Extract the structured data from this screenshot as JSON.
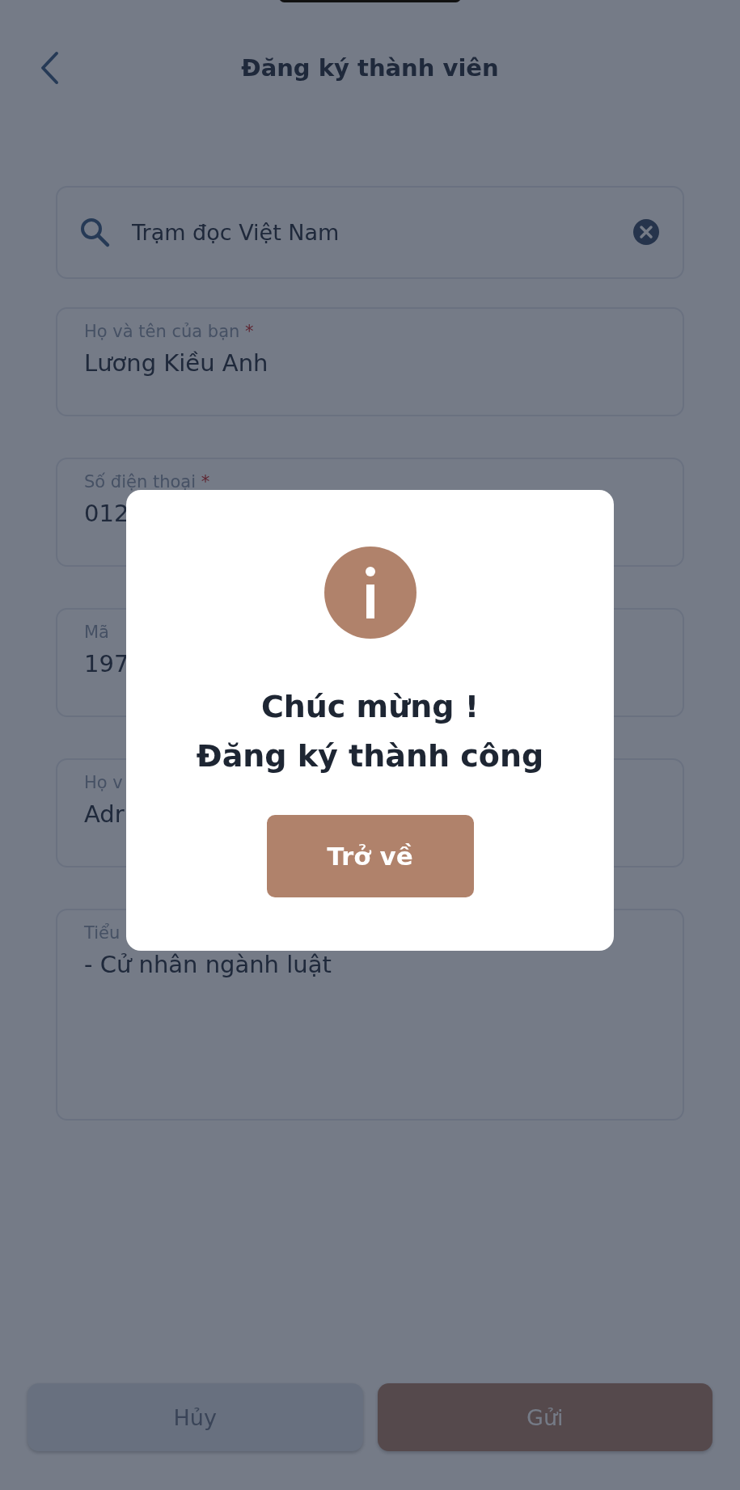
{
  "header": {
    "title": "Đăng ký thành viên"
  },
  "search": {
    "value": "Trạm đọc Việt Nam"
  },
  "fields": [
    {
      "label": "Họ và tên của bạn",
      "mark": "*",
      "value": "Lương Kiều Anh",
      "kind": "single"
    },
    {
      "label": "Số điện thoại",
      "mark": "*",
      "value": "012",
      "kind": "single"
    },
    {
      "label": "Mã",
      "value": "197",
      "kind": "single"
    },
    {
      "label": "Họ v",
      "value": "Adr",
      "kind": "single"
    },
    {
      "label": "Tiểu",
      "value": "- Cử nhân ngành luật",
      "kind": "multi"
    }
  ],
  "actions": [
    {
      "label": "Hủy",
      "kind": "secondary"
    },
    {
      "label": "Gửi",
      "kind": "primary"
    }
  ],
  "dialog": {
    "title_lines": [
      "Chúc mừng !",
      "Đăng ký thành công"
    ],
    "button": "Trở về"
  }
}
